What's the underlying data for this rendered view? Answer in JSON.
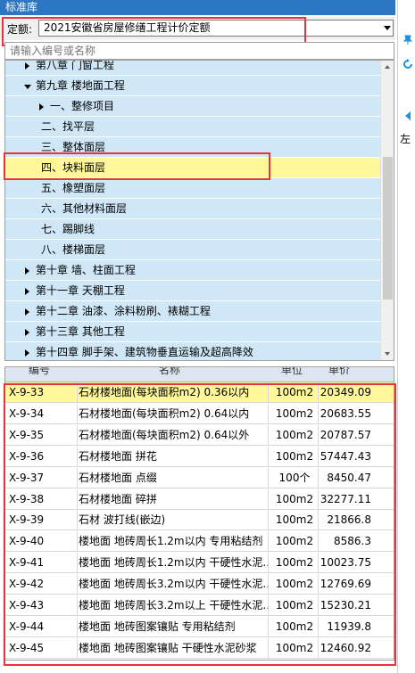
{
  "panel": {
    "title": "标准库"
  },
  "quota": {
    "label": "定额:",
    "selected": "2021安徽省房屋修缮工程计价定额"
  },
  "search": {
    "placeholder": "请输入编号或名称"
  },
  "tree": {
    "items": [
      {
        "label": "第八章 门窗工程",
        "level": 0,
        "state": "collapsed"
      },
      {
        "label": "第九章 楼地面工程",
        "level": 0,
        "state": "expanded"
      },
      {
        "label": "一、整修项目",
        "level": 1,
        "state": "collapsed"
      },
      {
        "label": "二、找平层",
        "level": 2,
        "state": "leaf"
      },
      {
        "label": "三、整体面层",
        "level": 2,
        "state": "leaf"
      },
      {
        "label": "四、块料面层",
        "level": 2,
        "state": "leaf",
        "selected": true
      },
      {
        "label": "五、橡塑面层",
        "level": 2,
        "state": "leaf"
      },
      {
        "label": "六、其他材料面层",
        "level": 2,
        "state": "leaf"
      },
      {
        "label": "七、踢脚线",
        "level": 2,
        "state": "leaf"
      },
      {
        "label": "八、楼梯面层",
        "level": 2,
        "state": "leaf"
      },
      {
        "label": "第十章 墙、柱面工程",
        "level": 0,
        "state": "collapsed"
      },
      {
        "label": "第十一章 天棚工程",
        "level": 0,
        "state": "collapsed"
      },
      {
        "label": "第十二章 油漆、涂料粉刷、裱糊工程",
        "level": 0,
        "state": "collapsed"
      },
      {
        "label": "第十三章 其他工程",
        "level": 0,
        "state": "collapsed"
      },
      {
        "label": "第十四章 脚手架、建筑物垂直运输及超高降效",
        "level": 0,
        "state": "collapsed"
      }
    ]
  },
  "table": {
    "headers": {
      "code": "编号",
      "name": "名称",
      "unit": "单位",
      "price": "单价"
    },
    "rows": [
      {
        "code": "X-9-33",
        "name": "石材楼地面(每块面积m2) 0.36以内",
        "unit": "100m2",
        "price": "20349.09",
        "selected": true
      },
      {
        "code": "X-9-34",
        "name": "石材楼地面(每块面积m2) 0.64以内",
        "unit": "100m2",
        "price": "20683.55"
      },
      {
        "code": "X-9-35",
        "name": "石材楼地面(每块面积m2) 0.64以外",
        "unit": "100m2",
        "price": "20787.57"
      },
      {
        "code": "X-9-36",
        "name": "石材楼地面 拼花",
        "unit": "100m2",
        "price": "57447.43"
      },
      {
        "code": "X-9-37",
        "name": "石材楼地面 点缀",
        "unit": "100个",
        "price": "8450.47"
      },
      {
        "code": "X-9-38",
        "name": "石材楼地面 碎拼",
        "unit": "100m2",
        "price": "32277.11"
      },
      {
        "code": "X-9-39",
        "name": "石材 波打线(嵌边)",
        "unit": "100m2",
        "price": "21866.8"
      },
      {
        "code": "X-9-40",
        "name": "楼地面 地砖周长1.2m以内 专用粘结剂",
        "unit": "100m2",
        "price": "8586.3"
      },
      {
        "code": "X-9-41",
        "name": "楼地面 地砖周长1.2m以内 干硬性水泥...",
        "unit": "100m2",
        "price": "10023.75"
      },
      {
        "code": "X-9-42",
        "name": "楼地面 地砖周长3.2m以内 干硬性水泥...",
        "unit": "100m2",
        "price": "12769.69"
      },
      {
        "code": "X-9-43",
        "name": "楼地面 地砖周长3.2m以上 干硬性水泥...",
        "unit": "100m2",
        "price": "15230.21"
      },
      {
        "code": "X-9-44",
        "name": "楼地面 地砖图案镶贴 专用粘结剂",
        "unit": "100m2",
        "price": "11939.8"
      },
      {
        "code": "X-9-45",
        "name": "楼地面 地砖图案镶贴 干硬性水泥砂浆",
        "unit": "100m2",
        "price": "12460.92"
      }
    ]
  },
  "sidebar": {
    "label": "左"
  },
  "colors": {
    "highlight": "#fff799",
    "tree_bg": "#cfe7f7",
    "title_bar": "#2d76c1",
    "annotation": "#e8333c",
    "side_icon": "#1f8fe0"
  }
}
